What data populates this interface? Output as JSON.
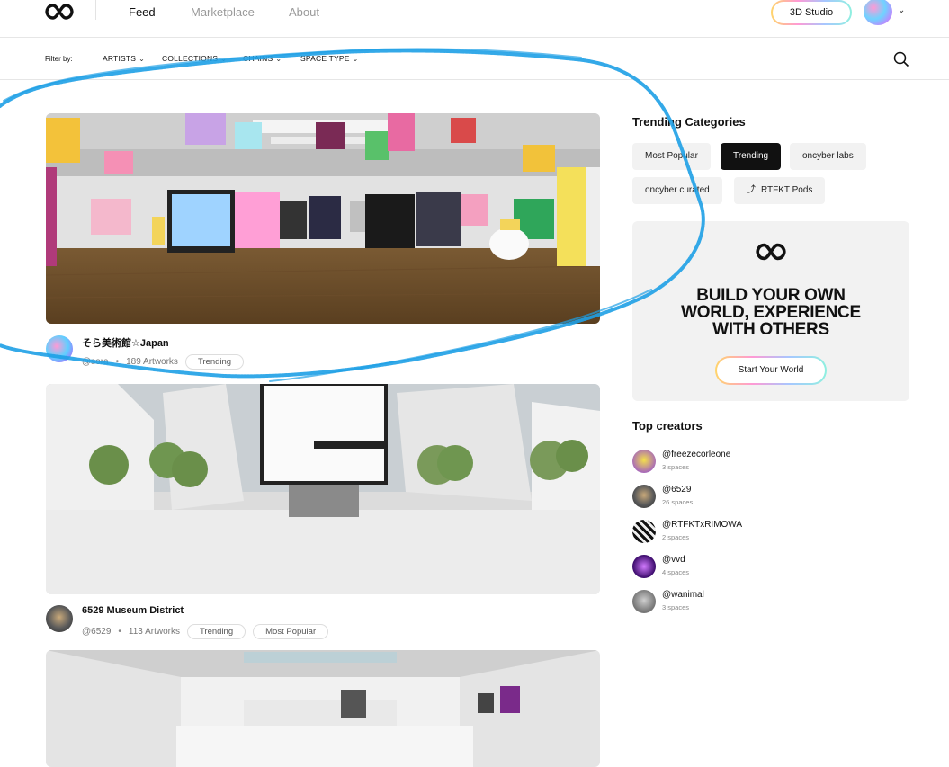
{
  "nav": {
    "feed": "Feed",
    "marketplace": "Marketplace",
    "about": "About",
    "studio_button": "3D Studio"
  },
  "filters": {
    "label": "Filter by:",
    "items": [
      "ARTISTS",
      "COLLECTIONS",
      "CHAINS",
      "SPACE TYPE"
    ]
  },
  "feed": [
    {
      "title": "そら美術館☆Japan",
      "handle": "@sora",
      "artworks": "189 Artworks",
      "tags": [
        "Trending"
      ]
    },
    {
      "title": "6529 Museum District",
      "handle": "@6529",
      "artworks": "113 Artworks",
      "tags": [
        "Trending",
        "Most Popular"
      ]
    }
  ],
  "sidebar": {
    "trending_title": "Trending Categories",
    "categories": [
      "Most Popular",
      "Trending",
      "oncyber labs",
      "oncyber curated",
      "RTFKT Pods"
    ],
    "promo": {
      "line1": "BUILD YOUR OWN",
      "line2": "WORLD, EXPERIENCE",
      "line3": "WITH OTHERS",
      "button": "Start Your World"
    },
    "top_creators_title": "Top creators",
    "creators": [
      {
        "name": "@freezecorleone",
        "count": "3 spaces"
      },
      {
        "name": "@6529",
        "count": "26 spaces"
      },
      {
        "name": "@RTFKTxRIMOWA",
        "count": "2 spaces"
      },
      {
        "name": "@vvd",
        "count": "4 spaces"
      },
      {
        "name": "@wanimal",
        "count": "3 spaces"
      }
    ]
  },
  "colors": {
    "accent_black": "#111111",
    "scribble_blue": "#1ea0e6"
  }
}
